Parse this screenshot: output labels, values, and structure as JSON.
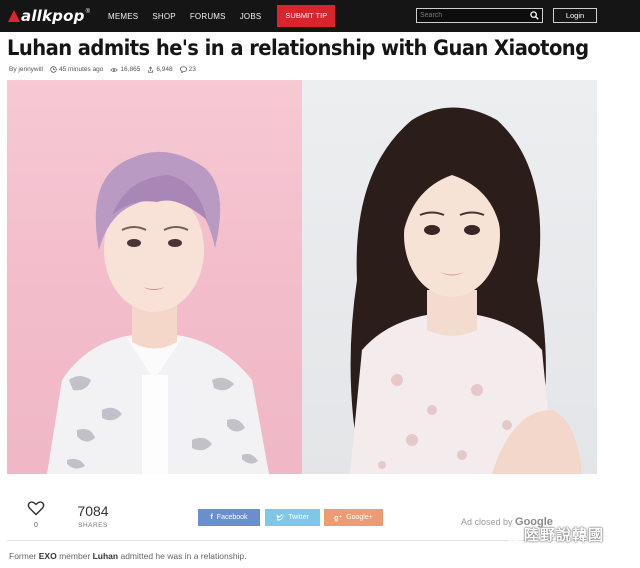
{
  "header": {
    "logo_text": "allkpop",
    "logo_mark": "®",
    "nav": [
      "MEMES",
      "SHOP",
      "FORUMS",
      "JOBS"
    ],
    "submit_tip": "SUBMIT TIP",
    "search_placeholder": "Search",
    "login_label": "Login",
    "accent_color": "#d9232d"
  },
  "article": {
    "title": "Luhan admits he's in a relationship with Guan Xiaotong",
    "author": "By jennywill",
    "time": "45 minutes ago",
    "views": "16,865",
    "shares_meta": "6,948",
    "comments": "23",
    "caption_prefix": "Former ",
    "caption_group": "EXO",
    "caption_mid": " member ",
    "caption_name": "Luhan",
    "caption_suffix": " admitted he was in a relationship."
  },
  "social": {
    "like_count": "0",
    "shares_count": "7084",
    "shares_label": "SHARES",
    "facebook": "Facebook",
    "twitter": "Twitter",
    "google": "Google+",
    "ad_text": "Ad closed by ",
    "ad_brand": "Google"
  },
  "watermark": {
    "text": "陸野說韓國"
  },
  "icons": [
    "clock-icon",
    "eye-icon",
    "share-icon",
    "comment-icon",
    "search-icon",
    "heart-icon",
    "wechat-icon"
  ]
}
